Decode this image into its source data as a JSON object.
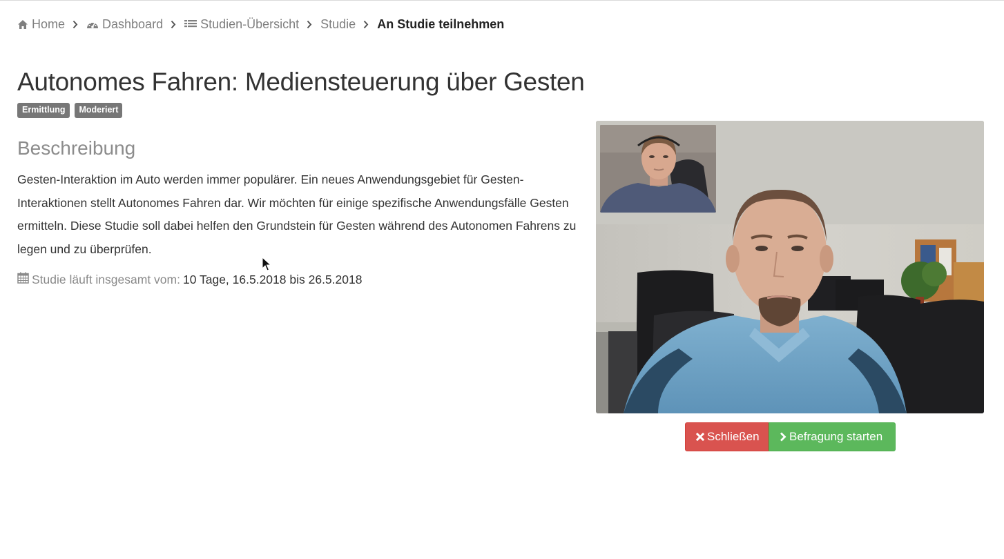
{
  "breadcrumb": [
    {
      "label": "Home",
      "icon": "home-icon"
    },
    {
      "label": "Dashboard",
      "icon": "dashboard-icon"
    },
    {
      "label": "Studien-Übersicht",
      "icon": "list-icon"
    },
    {
      "label": "Studie"
    },
    {
      "label": "An Studie teilnehmen",
      "active": true
    }
  ],
  "study": {
    "title": "Autonomes Fahren: Mediensteuerung über Gesten",
    "badges": [
      "Ermittlung",
      "Moderiert"
    ],
    "description_heading": "Beschreibung",
    "description": "Gesten-Interaktion im Auto werden immer populärer. Ein neues Anwendungsgebiet für Gesten-Interaktionen stellt Autonomes Fahren dar. Wir möchten für einige spezifische Anwendungsfälle Gesten ermitteln. Diese Studie soll dabei helfen den Grundstein für Gesten während des Autonomen Fahrens zu legen und zu überprüfen.",
    "duration_label": "Studie läuft insgesamt vom:",
    "duration_value": "10 Tage, 16.5.2018 bis 26.5.2018"
  },
  "actions": {
    "close_label": "Schließen",
    "start_label": "Befragung starten"
  },
  "colors": {
    "danger": "#d9534f",
    "success": "#5cb85c",
    "badge": "#777777"
  }
}
